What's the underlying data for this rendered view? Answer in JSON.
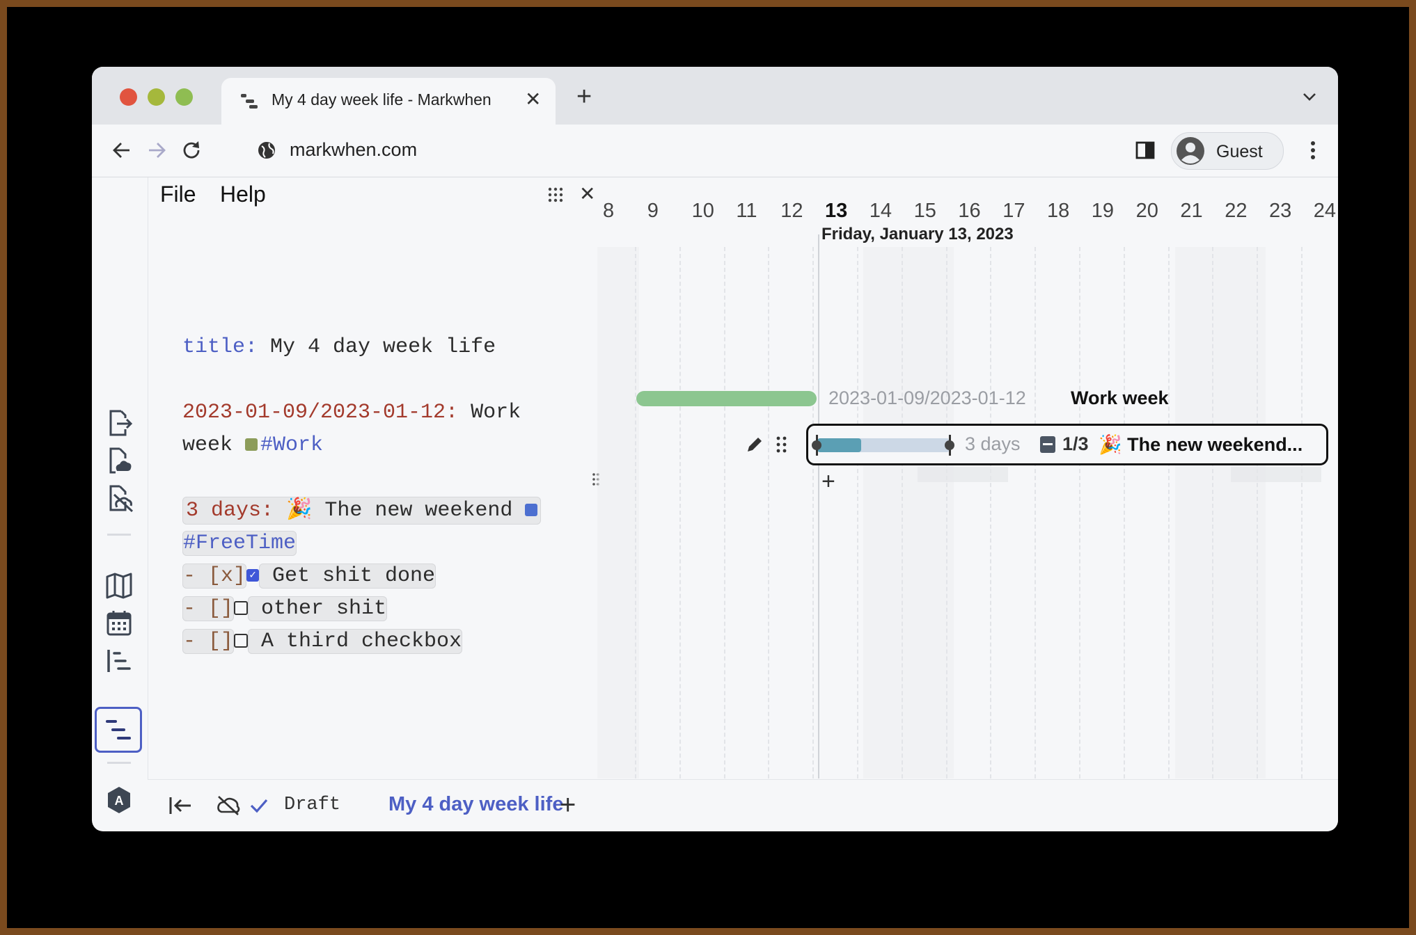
{
  "browser": {
    "tab_title": "My 4 day week life - Markwhen",
    "url": "markwhen.com",
    "profile_label": "Guest"
  },
  "menu": {
    "file": "File",
    "help": "Help"
  },
  "editor": {
    "title_key": "title:",
    "title_value": " My 4 day week life",
    "event1_date": "2023-01-09/2023-01-12:",
    "event1_text_a": " Work",
    "event1_text_b": "week ",
    "event1_tag": "#Work",
    "event2_date": "3 days:",
    "event2_text": " 🎉 The new weekend ",
    "event2_tag": "#FreeTime",
    "checklist": [
      {
        "marker": "- [x]",
        "label": " Get shit done",
        "checked": true
      },
      {
        "marker": "- []",
        "label": " other shit",
        "checked": false
      },
      {
        "marker": "- []",
        "label": " A third checkbox",
        "checked": false
      }
    ]
  },
  "timeline": {
    "days": [
      "8",
      "9",
      "10",
      "11",
      "12",
      "13",
      "14",
      "15",
      "16",
      "17",
      "18",
      "19",
      "20",
      "21",
      "22",
      "23",
      "24"
    ],
    "current_day": "13",
    "current_date_label": "Friday, January 13, 2023",
    "event1": {
      "range_label": "2023-01-09/2023-01-12",
      "title": "Work week",
      "color": "#8cc690"
    },
    "event2": {
      "duration_label": "3 days",
      "progress_label": "1/3",
      "title": "🎉 The new weekend...",
      "progress": 0.333,
      "color": "#5b9fb4"
    },
    "add_label": "+"
  },
  "bottom": {
    "status": "Draft",
    "document_title": "My 4 day week life",
    "add_label": "+"
  },
  "colors": {
    "accent": "#4d5fc4",
    "date": "#a33a2c",
    "work": "#8cc690",
    "free": "#5b9fb4"
  },
  "icons": [
    "export-icon",
    "cloud-upload-icon",
    "file-unlink-icon",
    "map-icon",
    "calendar-icon",
    "list-view-icon",
    "timeline-view-icon",
    "settings-a-icon"
  ]
}
